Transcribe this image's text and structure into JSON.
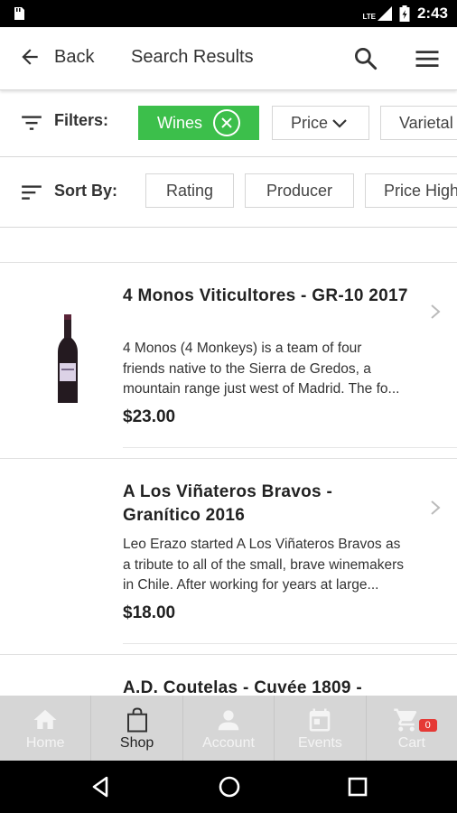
{
  "status_bar": {
    "time": "2:43",
    "network": "LTE",
    "icons": [
      "notification-icon",
      "lte-signal-icon",
      "battery-icon"
    ]
  },
  "app_bar": {
    "back_label": "Back",
    "title": "Search Results",
    "icons": [
      "back-arrow-icon",
      "search-icon",
      "hamburger-menu-icon"
    ]
  },
  "filters": {
    "label": "Filters:",
    "chips": [
      {
        "label": "Wines",
        "active": true
      },
      {
        "label": "Price"
      },
      {
        "label": "Varietal"
      }
    ]
  },
  "sort": {
    "label": "Sort By:",
    "options": [
      "Rating",
      "Producer",
      "Price High"
    ]
  },
  "products": [
    {
      "name": "4 Monos Viticultores - GR-10 2017",
      "description": [
        "4 Monos (4 Monkeys) is a team of four",
        "friends native to the Sierra de Gredos, a",
        "mountain range just west of Madrid. The fo..."
      ],
      "price": "$23.00"
    },
    {
      "name": "A Los Viñateros Bravos - Granítico 2016",
      "description": [
        "Leo Erazo started A Los Viñateros Bravos as",
        "a tribute to all of the small, brave winemakers",
        "in Chile. After working for years at large..."
      ],
      "price": "$18.00"
    },
    {
      "name": "A.D. Coutelas - Cuvée 1809 -",
      "description": [],
      "price": ""
    }
  ],
  "tab_bar": {
    "tabs": [
      {
        "label": "Home",
        "icon": "home-icon"
      },
      {
        "label": "Shop",
        "icon": "shopping-bag-icon",
        "selected": true
      },
      {
        "label": "Account",
        "icon": "person-icon"
      },
      {
        "label": "Events",
        "icon": "calendar-icon"
      },
      {
        "label": "Cart",
        "icon": "cart-icon",
        "badge": "0"
      }
    ]
  },
  "colors": {
    "accent_green": "#3cbf4b",
    "tab_bar_bg": "#d6d6d6",
    "badge_red": "#e53935"
  }
}
